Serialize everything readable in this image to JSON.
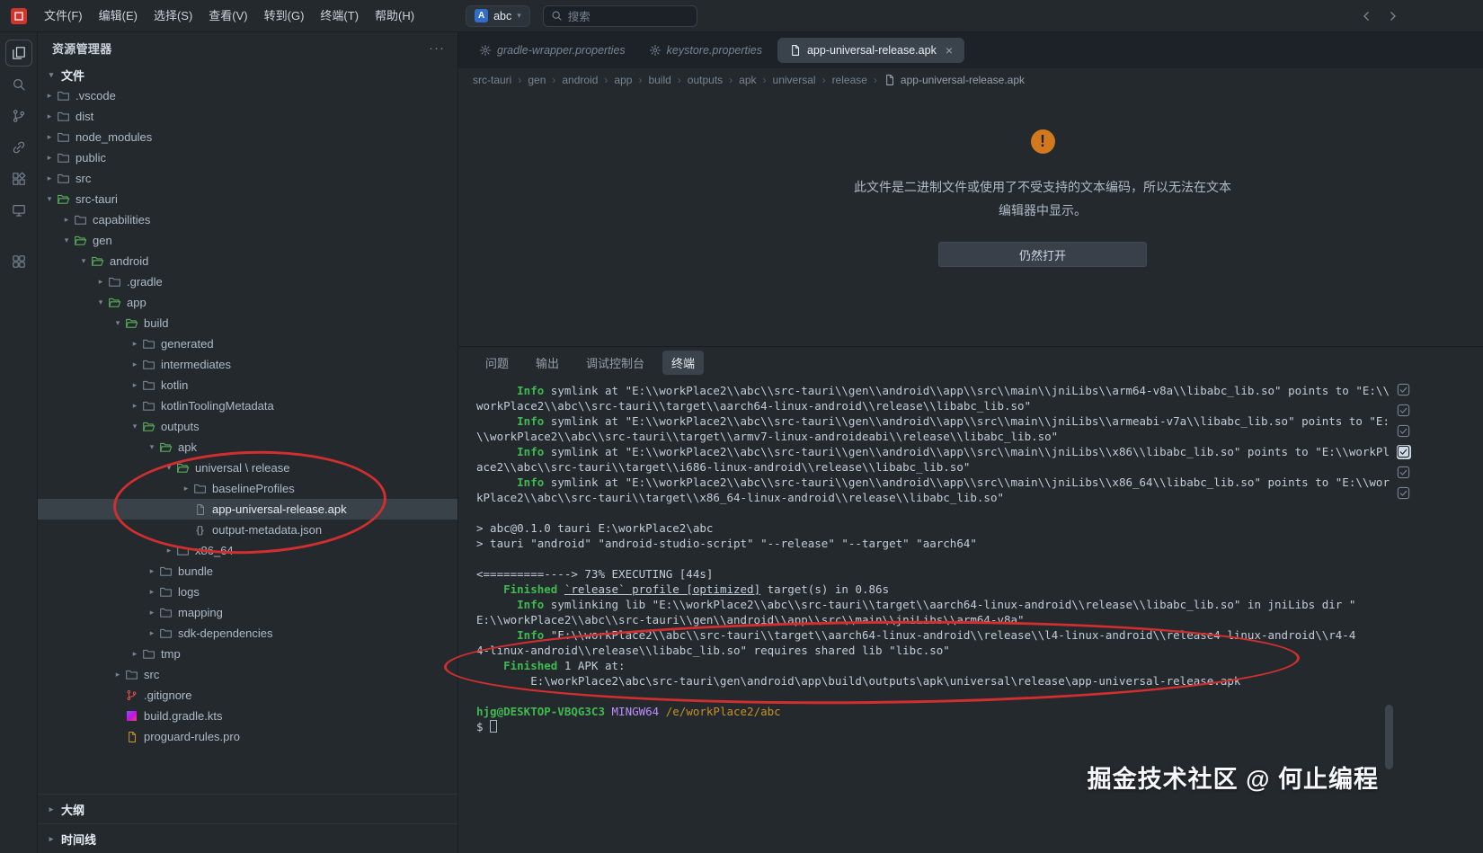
{
  "titlebar": {
    "menus": [
      "文件(F)",
      "编辑(E)",
      "选择(S)",
      "查看(V)",
      "转到(G)",
      "终端(T)",
      "帮助(H)"
    ],
    "project": {
      "avatar_letter": "A",
      "name": "abc"
    },
    "search_placeholder": "搜索"
  },
  "activity_bar": {
    "icons": [
      "explorer-icon",
      "search-icon",
      "source-control-icon",
      "remote-link-icon",
      "extensions-icon",
      "screen-icon",
      "apps-grid-icon"
    ],
    "active_index": 0
  },
  "sidebar": {
    "title": "资源管理器",
    "section_label": "文件",
    "outline_label": "大纲",
    "timeline_label": "时间线",
    "tree": [
      {
        "l": 1,
        "c": ">",
        "k": "f",
        "t": ".vscode"
      },
      {
        "l": 1,
        "c": ">",
        "k": "f",
        "t": "dist"
      },
      {
        "l": 1,
        "c": ">",
        "k": "f",
        "t": "node_modules"
      },
      {
        "l": 1,
        "c": ">",
        "k": "f",
        "t": "public"
      },
      {
        "l": 1,
        "c": ">",
        "k": "f",
        "t": "src"
      },
      {
        "l": 1,
        "c": "v",
        "k": "o",
        "t": "src-tauri"
      },
      {
        "l": 2,
        "c": ">",
        "k": "f",
        "t": "capabilities"
      },
      {
        "l": 2,
        "c": "v",
        "k": "o",
        "t": "gen"
      },
      {
        "l": 3,
        "c": "v",
        "k": "o",
        "t": "android"
      },
      {
        "l": 4,
        "c": ">",
        "k": "f",
        "t": ".gradle"
      },
      {
        "l": 4,
        "c": "v",
        "k": "o",
        "t": "app"
      },
      {
        "l": 5,
        "c": "v",
        "k": "o",
        "t": "build"
      },
      {
        "l": 6,
        "c": ">",
        "k": "f",
        "t": "generated"
      },
      {
        "l": 6,
        "c": ">",
        "k": "f",
        "t": "intermediates"
      },
      {
        "l": 6,
        "c": ">",
        "k": "f",
        "t": "kotlin"
      },
      {
        "l": 6,
        "c": ">",
        "k": "f",
        "t": "kotlinToolingMetadata"
      },
      {
        "l": 6,
        "c": "v",
        "k": "o",
        "t": "outputs"
      },
      {
        "l": 7,
        "c": "v",
        "k": "o",
        "t": "apk"
      },
      {
        "l": 8,
        "c": "v",
        "k": "o",
        "t": "universal \\ release"
      },
      {
        "l": 9,
        "c": ">",
        "k": "f",
        "t": "baselineProfiles"
      },
      {
        "l": 9,
        "c": "",
        "k": "file",
        "t": "app-universal-release.apk",
        "sel": true
      },
      {
        "l": 9,
        "c": "",
        "k": "json",
        "t": "output-metadata.json"
      },
      {
        "l": 8,
        "c": ">",
        "k": "f",
        "t": "x86_64"
      },
      {
        "l": 7,
        "c": ">",
        "k": "f",
        "t": "bundle"
      },
      {
        "l": 7,
        "c": ">",
        "k": "f",
        "t": "logs"
      },
      {
        "l": 7,
        "c": ">",
        "k": "f",
        "t": "mapping"
      },
      {
        "l": 7,
        "c": ">",
        "k": "f",
        "t": "sdk-dependencies"
      },
      {
        "l": 6,
        "c": ">",
        "k": "f",
        "t": "tmp"
      },
      {
        "l": 5,
        "c": ">",
        "k": "f",
        "t": "src"
      },
      {
        "l": 5,
        "c": "",
        "k": "git",
        "t": ".gitignore"
      },
      {
        "l": 5,
        "c": "",
        "k": "kt",
        "t": "build.gradle.kts"
      },
      {
        "l": 5,
        "c": "",
        "k": "pro",
        "t": "proguard-rules.pro"
      }
    ]
  },
  "editor": {
    "tabs": [
      {
        "label": "gradle-wrapper.properties",
        "icon": "gear",
        "active": false,
        "italic": true
      },
      {
        "label": "keystore.properties",
        "icon": "gear",
        "active": false,
        "italic": true
      },
      {
        "label": "app-universal-release.apk",
        "icon": "file",
        "active": true,
        "italic": false,
        "close": "×"
      }
    ],
    "breadcrumbs": [
      "src-tauri",
      "gen",
      "android",
      "app",
      "build",
      "outputs",
      "apk",
      "universal",
      "release"
    ],
    "breadcrumb_file": "app-universal-release.apk",
    "notice": {
      "icon_mark": "!",
      "line1": "此文件是二进制文件或使用了不受支持的文本编码，所以无法在文本",
      "line2": "编辑器中显示。",
      "button_label": "仍然打开"
    }
  },
  "panel": {
    "tabs": [
      {
        "label": "问题",
        "active": false
      },
      {
        "label": "输出",
        "active": false
      },
      {
        "label": "调试控制台",
        "active": false
      },
      {
        "label": "终端",
        "active": true
      }
    ],
    "terminal_lines": [
      [
        [
          "d",
          "      "
        ],
        [
          "g",
          "Info"
        ],
        [
          "d",
          " symlink at \"E:\\\\workPlace2\\\\abc\\\\src-tauri\\\\gen\\\\android\\\\app\\\\src\\\\main\\\\jniLibs\\\\arm64-v8a\\\\libabc_lib.so\" points to \"E:\\\\"
        ]
      ],
      [
        [
          "d",
          "workPlace2\\\\abc\\\\src-tauri\\\\target\\\\aarch64-linux-android\\\\release\\\\libabc_lib.so\""
        ]
      ],
      [
        [
          "d",
          "      "
        ],
        [
          "g",
          "Info"
        ],
        [
          "d",
          " symlink at \"E:\\\\workPlace2\\\\abc\\\\src-tauri\\\\gen\\\\android\\\\app\\\\src\\\\main\\\\jniLibs\\\\armeabi-v7a\\\\libabc_lib.so\" points to \"E:"
        ]
      ],
      [
        [
          "d",
          "\\\\workPlace2\\\\abc\\\\src-tauri\\\\target\\\\armv7-linux-androideabi\\\\release\\\\libabc_lib.so\""
        ]
      ],
      [
        [
          "d",
          "      "
        ],
        [
          "g",
          "Info"
        ],
        [
          "d",
          " symlink at \"E:\\\\workPlace2\\\\abc\\\\src-tauri\\\\gen\\\\android\\\\app\\\\src\\\\main\\\\jniLibs\\\\x86\\\\libabc_lib.so\" points to \"E:\\\\workPl"
        ]
      ],
      [
        [
          "d",
          "ace2\\\\abc\\\\src-tauri\\\\target\\\\i686-linux-android\\\\release\\\\libabc_lib.so\""
        ]
      ],
      [
        [
          "d",
          "      "
        ],
        [
          "g",
          "Info"
        ],
        [
          "d",
          " symlink at \"E:\\\\workPlace2\\\\abc\\\\src-tauri\\\\gen\\\\android\\\\app\\\\src\\\\main\\\\jniLibs\\\\x86_64\\\\libabc_lib.so\" points to \"E:\\\\wor"
        ]
      ],
      [
        [
          "d",
          "kPlace2\\\\abc\\\\src-tauri\\\\target\\\\x86_64-linux-android\\\\release\\\\libabc_lib.so\""
        ]
      ],
      [],
      [
        [
          "d",
          "> abc@0.1.0 tauri E:\\workPlace2\\abc"
        ]
      ],
      [
        [
          "d",
          "> tauri \"android\" \"android-studio-script\" \"--release\" \"--target\" \"aarch64\""
        ]
      ],
      [],
      [
        [
          "d",
          "<=========----> 73% EXECUTING [44s]"
        ]
      ],
      [
        [
          "d",
          "    "
        ],
        [
          "g",
          "Finished"
        ],
        [
          "d",
          " "
        ],
        [
          "u",
          "`release` profile [optimized]"
        ],
        [
          "d",
          " target(s) in 0.86s"
        ]
      ],
      [
        [
          "d",
          "      "
        ],
        [
          "g",
          "Info"
        ],
        [
          "d",
          " symlinking lib \"E:\\\\workPlace2\\\\abc\\\\src-tauri\\\\target\\\\aarch64-linux-android\\\\release\\\\libabc_lib.so\" in jniLibs dir \""
        ]
      ],
      [
        [
          "d",
          "E:\\\\workPlace2\\\\abc\\\\src-tauri\\\\gen\\\\android\\\\app\\\\src\\\\main\\\\jniLibs\\\\arm64-v8a\""
        ]
      ],
      [
        [
          "d",
          "      "
        ],
        [
          "g",
          "Info"
        ],
        [
          "d",
          " \"E:\\\\workPlace2\\\\abc\\\\src-tauri\\\\target\\\\aarch64-linux-android\\\\release\\\\l4-linux-android\\\\release4-linux-android\\\\r4-4"
        ]
      ],
      [
        [
          "d",
          "4-linux-android\\\\release\\\\libabc_lib.so\" requires shared lib \"libc.so\""
        ]
      ],
      [
        [
          "d",
          "    "
        ],
        [
          "g",
          "Finished"
        ],
        [
          "d",
          " 1 APK at:"
        ]
      ],
      [
        [
          "d",
          "        E:\\workPlace2\\abc\\src-tauri\\gen\\android\\app\\build\\outputs\\apk\\universal\\release\\app-universal-release.apk"
        ]
      ],
      [],
      [
        [
          "p",
          "hjg@DESKTOP-VBQG3C3"
        ],
        [
          "d",
          " "
        ],
        [
          "m",
          "MINGW64"
        ],
        [
          "d",
          " "
        ],
        [
          "y",
          "/e/workPlace2/abc"
        ]
      ],
      [
        [
          "d",
          "$ "
        ],
        [
          "c",
          ""
        ]
      ]
    ]
  },
  "watermark": "掘金技术社区 @ 何止编程",
  "colors": {
    "accent_green": "#3fb950",
    "open_folder_green": "#57ab5a",
    "warning_orange": "#d2791e",
    "annotation_red": "#d12f2f",
    "selection": "#394149",
    "magenta": "#bc8cff",
    "yellow": "#c69026"
  }
}
